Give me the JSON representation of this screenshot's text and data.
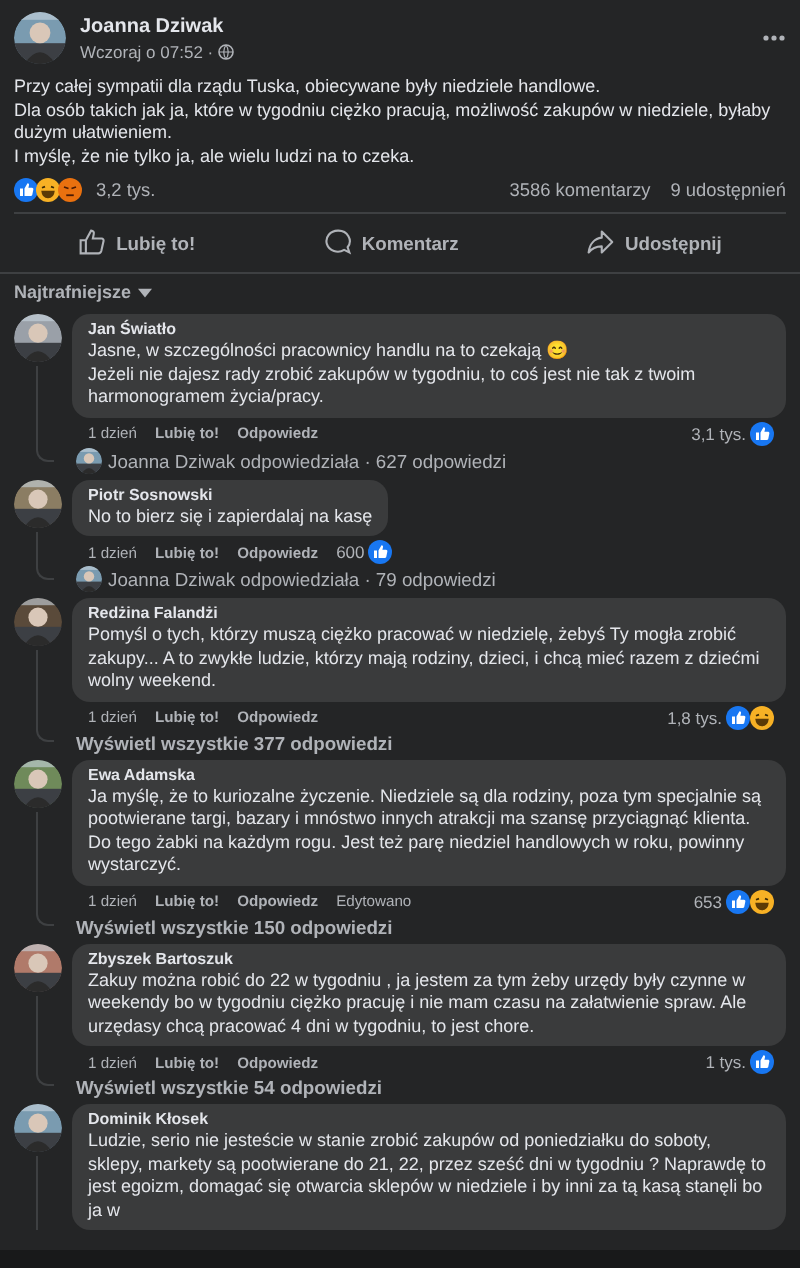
{
  "post": {
    "author": "Joanna Dziwak",
    "time": "Wczoraj o 07:52 ·",
    "paragraphs": [
      "Przy całej sympatii dla rządu Tuska, obiecywane były niedziele handlowe.",
      "Dla osób takich jak ja, które w tygodniu ciężko pracują, możliwość zakupów w niedziele, byłaby dużym ułatwieniem.",
      "I myślę, że nie tylko ja, ale wielu ludzi na to czeka."
    ],
    "reactions": [
      {
        "kind": "like"
      },
      {
        "kind": "haha"
      },
      {
        "kind": "angry"
      }
    ],
    "reaction_count": "3,2 tys.",
    "comments_count": "3586 komentarzy",
    "shares": "9 udostępnień",
    "actions": [
      {
        "kind": "like",
        "label": "Lubię to!"
      },
      {
        "kind": "comment",
        "label": "Komentarz"
      },
      {
        "kind": "share",
        "label": "Udostępnij"
      }
    ]
  },
  "sort": "Najtrafniejsze",
  "comments": [
    {
      "author": "Jan Światło",
      "paragraphs": [
        "Jasne, w szczególności pracownicy handlu na to czekają 😊",
        "Jeżeli nie dajesz rady zrobić zakupów w tygodniu, to coś jest nie tak z twoim harmonogramem życia/pracy."
      ],
      "meta": [
        "1 dzień",
        "Lubię to!",
        "Odpowiedz"
      ],
      "reaction_count": "3,1 tys.",
      "reactions": [
        {
          "kind": "like"
        }
      ],
      "replies": {
        "kind": "author_reply",
        "text": "Joanna Dziwak odpowiedziała · 627 odpowiedzi"
      }
    },
    {
      "author": "Piotr Sosnowski",
      "paragraphs": [
        "No to bierz się i zapierdalaj na kasę"
      ],
      "meta": [
        "1 dzień",
        "Lubię to!",
        "Odpowiedz"
      ],
      "reaction_count": "600",
      "reactions": [
        {
          "kind": "like"
        }
      ],
      "replies": {
        "kind": "author_reply",
        "text": "Joanna Dziwak odpowiedziała · 79 odpowiedzi"
      }
    },
    {
      "author": "Redżina Falandżi",
      "paragraphs": [
        "Pomyśl o tych, którzy muszą ciężko pracować w niedzielę, żebyś Ty mogła zrobić zakupy... A to zwykłe ludzie, którzy mają rodziny, dzieci, i chcą mieć razem z dziećmi wolny weekend."
      ],
      "meta": [
        "1 dzień",
        "Lubię to!",
        "Odpowiedz"
      ],
      "reaction_count": "1,8 tys.",
      "reactions": [
        {
          "kind": "like"
        },
        {
          "kind": "haha"
        }
      ],
      "replies": {
        "kind": "view_all",
        "text": "Wyświetl wszystkie 377 odpowiedzi"
      }
    },
    {
      "author": "Ewa Adamska",
      "paragraphs": [
        "Ja myślę, że to kuriozalne życzenie. Niedziele są dla rodziny, poza tym specjalnie są pootwierane targi, bazary i mnóstwo innych atrakcji ma szansę przyciągnąć klienta. Do tego żabki na każdym rogu. Jest też parę niedziel handlowych w roku, powinny wystarczyć."
      ],
      "meta": [
        "1 dzień",
        "Lubię to!",
        "Odpowiedz",
        "Edytowano"
      ],
      "reaction_count": "653",
      "reactions": [
        {
          "kind": "like"
        },
        {
          "kind": "haha"
        }
      ],
      "replies": {
        "kind": "view_all",
        "text": "Wyświetl wszystkie 150 odpowiedzi"
      }
    },
    {
      "author": "Zbyszek Bartoszuk",
      "paragraphs": [
        "Zakuy można robić do 22 w tygodniu , ja jestem za tym żeby urzędy były czynne w weekendy bo w tygodniu ciężko pracuję i nie mam czasu na załatwienie spraw. Ale urzędasy chcą pracować 4 dni w tygodniu, to jest chore."
      ],
      "meta": [
        "1 dzień",
        "Lubię to!",
        "Odpowiedz"
      ],
      "reaction_count": "1 tys.",
      "reactions": [
        {
          "kind": "like"
        }
      ],
      "replies": {
        "kind": "view_all",
        "text": "Wyświetl wszystkie 54 odpowiedzi"
      }
    },
    {
      "author": "Dominik Kłosek",
      "paragraphs": [
        "Ludzie, serio nie jesteście w stanie zrobić zakupów od poniedziałku do soboty, sklepy, markety są pootwierane do 21, 22, przez sześć dni w tygodniu ? Naprawdę to jest egoizm, domagać się otwarcia sklepów w niedziele i by inni za tą kasą stanęli bo ja w"
      ]
    }
  ]
}
